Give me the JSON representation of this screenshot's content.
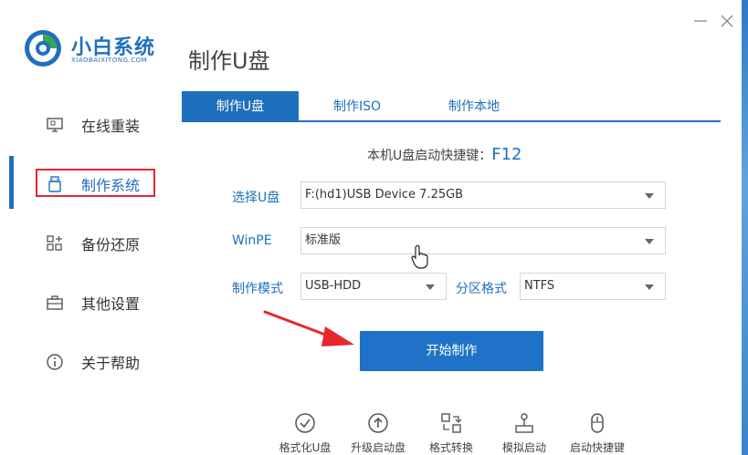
{
  "app": {
    "logo_title": "小白系统",
    "logo_subtitle": "XIAOBAIXITONG.COM"
  },
  "sidebar": {
    "items": [
      {
        "label": "在线重装",
        "icon": "monitor-icon",
        "active": false
      },
      {
        "label": "制作系统",
        "icon": "usb-drive-icon",
        "active": true
      },
      {
        "label": "备份还原",
        "icon": "grid-icon",
        "active": false
      },
      {
        "label": "其他设置",
        "icon": "briefcase-icon",
        "active": false
      },
      {
        "label": "关于帮助",
        "icon": "info-icon",
        "active": false
      }
    ]
  },
  "main": {
    "page_title": "制作U盘",
    "tabs": [
      {
        "label": "制作U盘",
        "active": true
      },
      {
        "label": "制作ISO",
        "active": false
      },
      {
        "label": "制作本地",
        "active": false
      }
    ],
    "hotkey_label": "本机U盘启动快捷键：",
    "hotkey_value": "F12",
    "form": {
      "usb_label": "选择U盘",
      "usb_value": "F:(hd1)USB Device 7.25GB",
      "winpe_label": "WinPE",
      "winpe_value": "标准版",
      "mode_label": "制作模式",
      "mode_value": "USB-HDD",
      "partition_label": "分区格式",
      "partition_value": "NTFS"
    },
    "start_button": "开始制作"
  },
  "toolbar": {
    "items": [
      {
        "label": "格式化U盘",
        "icon": "check-circle-icon"
      },
      {
        "label": "升级启动盘",
        "icon": "upload-circle-icon"
      },
      {
        "label": "格式转换",
        "icon": "convert-icon"
      },
      {
        "label": "模拟启动",
        "icon": "joystick-icon"
      },
      {
        "label": "启动快捷键",
        "icon": "mouse-icon"
      }
    ]
  },
  "colors": {
    "accent": "#1f6fbf",
    "highlight": "#e8262c"
  }
}
